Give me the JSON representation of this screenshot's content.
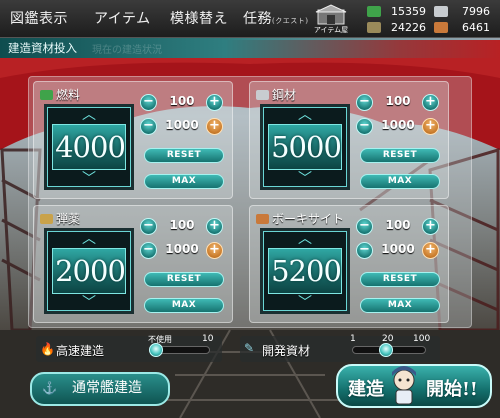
{
  "header": {
    "menu": [
      {
        "label": "図鑑表示"
      },
      {
        "label": "アイテム"
      },
      {
        "label": "模様替え"
      },
      {
        "label": "任務",
        "sub": "(クエスト)"
      }
    ],
    "item_shop_label": "アイテム屋",
    "resources": {
      "fuel": "15359",
      "steel": "7996",
      "ammo": "24226",
      "bauxite": "6461"
    }
  },
  "subheader": {
    "title": "建造資材投入",
    "ghost": "現在の建造状況"
  },
  "cards": [
    {
      "label": "燃料",
      "value": "4000",
      "step1": "100",
      "step2": "1000",
      "reset": "RESET",
      "max": "MAX",
      "color": "#3fa34a",
      "icon": "fuel-can-icon"
    },
    {
      "label": "鋼材",
      "value": "5000",
      "step1": "100",
      "step2": "1000",
      "reset": "RESET",
      "max": "MAX",
      "color": "#c8ccd0",
      "icon": "steel-icon"
    },
    {
      "label": "弾薬",
      "value": "2000",
      "step1": "100",
      "step2": "1000",
      "reset": "RESET",
      "max": "MAX",
      "color": "#c9a24a",
      "icon": "ammo-icon"
    },
    {
      "label": "ボーキサイト",
      "value": "5200",
      "step1": "100",
      "step2": "1000",
      "reset": "RESET",
      "max": "MAX",
      "color": "#c9793a",
      "icon": "bauxite-icon"
    }
  ],
  "options": {
    "fast_build": {
      "label": "高速建造",
      "off": "不使用",
      "count": "10"
    },
    "dev_material": {
      "label": "開発資材",
      "ticks": [
        "1",
        "20",
        "100"
      ]
    }
  },
  "buttons": {
    "normal_build": "通常艦建造",
    "start_a": "建造",
    "start_b": "開始!!"
  }
}
